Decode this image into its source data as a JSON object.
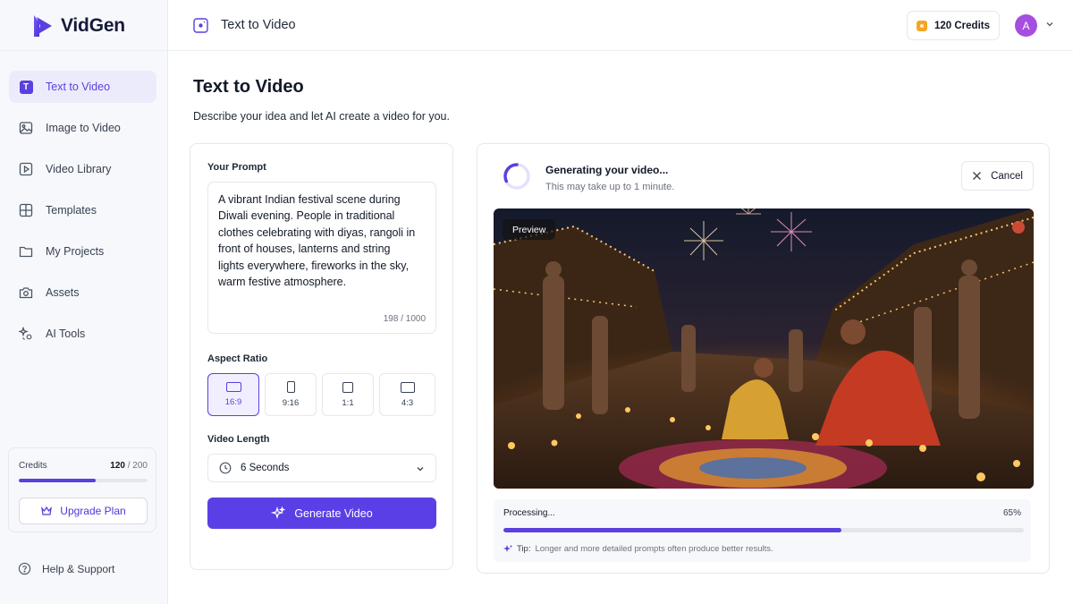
{
  "app": {
    "name": "VidGen",
    "brand_color": "#5b3fe0"
  },
  "sidebar": {
    "items": [
      {
        "label": "Text to Video",
        "icon": "text-icon",
        "active": true
      },
      {
        "label": "Image to Video",
        "icon": "image-icon"
      },
      {
        "label": "Video Library",
        "icon": "play-square-icon"
      },
      {
        "label": "Templates",
        "icon": "grid-icon"
      },
      {
        "label": "My Projects",
        "icon": "folder-icon"
      },
      {
        "label": "Assets",
        "icon": "camera-icon"
      },
      {
        "label": "AI Tools",
        "icon": "ai-tools-icon"
      }
    ],
    "credits": {
      "label": "Credits",
      "used": "120",
      "total": "/ 200",
      "fraction": 0.6
    },
    "upgrade_label": "Upgrade Plan",
    "help_label": "Help & Support"
  },
  "header": {
    "title": "Text to Video",
    "credits_label": "120 Credits",
    "avatar_initial": "A"
  },
  "main": {
    "title": "Text to Video",
    "subtitle": "Describe your idea and let AI create a video for you.",
    "prompt": {
      "label": "Your Prompt",
      "value": "A vibrant Indian festival scene during Diwali evening. People in traditional clothes celebrating with diyas, rangoli in front of houses, lanterns and string lights everywhere, fireworks in the sky, warm festive atmosphere.",
      "count": "198 / 1000"
    },
    "aspect_ratio": {
      "label": "Aspect Ratio",
      "options": [
        {
          "label": "16:9",
          "active": true
        },
        {
          "label": "9:16"
        },
        {
          "label": "1:1"
        },
        {
          "label": "4:3"
        }
      ]
    },
    "video_length": {
      "label": "Video Length",
      "value": "6 Seconds"
    },
    "generate_label": "Generate Video"
  },
  "generation": {
    "title": "Generating your video...",
    "subtitle": "This may take up to 1 minute.",
    "cancel_label": "Cancel",
    "preview_label": "Preview",
    "progress_label": "Processing...",
    "progress_text": "65%",
    "progress_fraction": 0.65,
    "tip_label": "Tip:",
    "tip_text": "Longer and more detailed prompts often produce better results."
  }
}
